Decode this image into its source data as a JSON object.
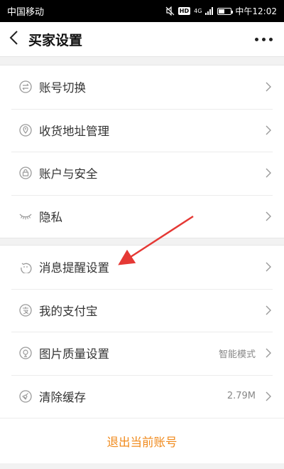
{
  "status_bar": {
    "carrier": "中国移动",
    "network": "4G",
    "hd": "HD",
    "time": "中午12:02",
    "battery_level": 0.5
  },
  "header": {
    "title": "买家设置"
  },
  "settings": [
    {
      "label": "账号切换",
      "value": "",
      "icon": "switch-account-icon"
    },
    {
      "label": "收货地址管理",
      "value": "",
      "icon": "location-pin-icon"
    },
    {
      "label": "账户与安全",
      "value": "",
      "icon": "lock-icon"
    },
    {
      "label": "隐私",
      "value": "",
      "icon": "eye-closed-icon"
    },
    {
      "label": "消息提醒设置",
      "value": "",
      "icon": "message-bubble-icon"
    },
    {
      "label": "我的支付宝",
      "value": "",
      "icon": "alipay-icon"
    },
    {
      "label": "图片质量设置",
      "value": "智能模式",
      "icon": "image-quality-icon"
    },
    {
      "label": "清除缓存",
      "value": "2.79M",
      "icon": "broom-icon"
    }
  ],
  "logout_label": "退出当前账号",
  "colors": {
    "accent": "#f08a1c",
    "annotation_arrow": "#e53935",
    "icon": "#9a9a9a"
  }
}
